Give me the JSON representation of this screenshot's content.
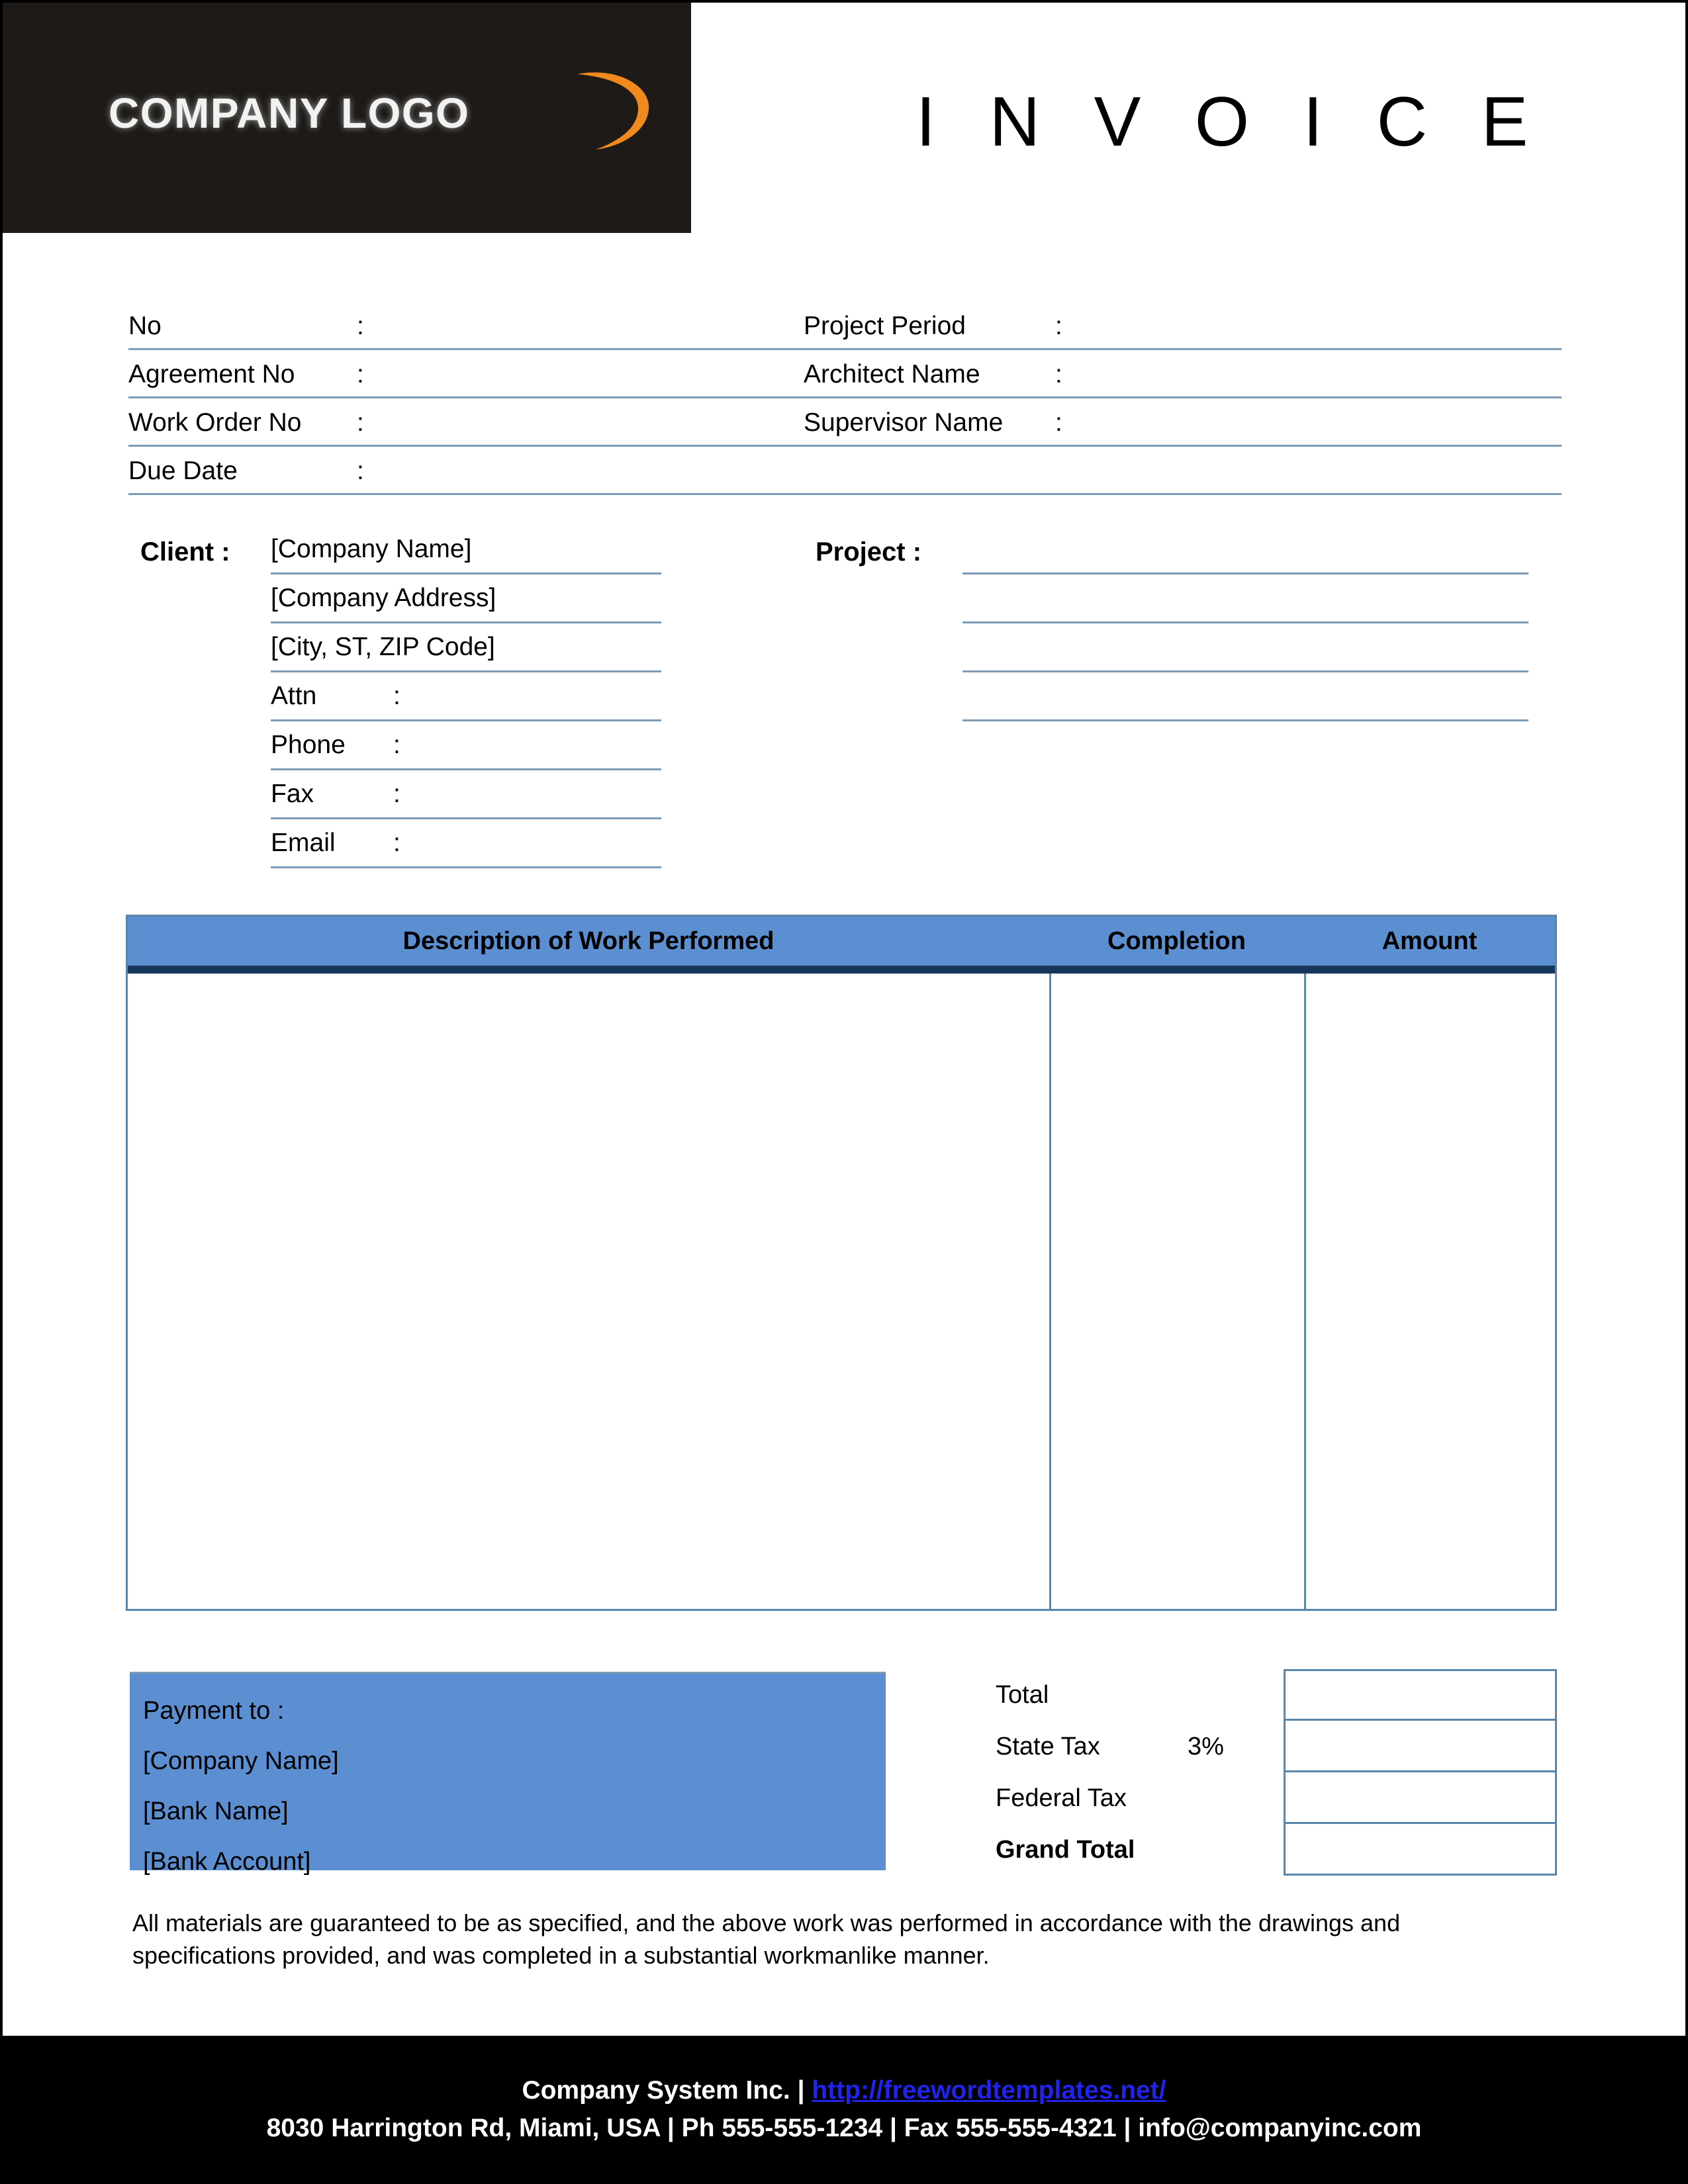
{
  "header": {
    "logo_text": "COMPANY LOGO",
    "logo_swoosh_icon": "orange-swoosh-icon",
    "title": "I N V O I C E"
  },
  "info_fields": [
    {
      "label": "No",
      "colon": ":",
      "value": "",
      "label2": "Project Period",
      "colon2": ":",
      "value2": ""
    },
    {
      "label": "Agreement No",
      "colon": ":",
      "value": "",
      "label2": "Architect Name",
      "colon2": ":",
      "value2": ""
    },
    {
      "label": "Work Order No",
      "colon": ":",
      "value": "",
      "label2": "Supervisor Name",
      "colon2": ":",
      "value2": ""
    },
    {
      "label": "Due Date",
      "colon": ":",
      "value": "",
      "label2": "",
      "colon2": "",
      "value2": ""
    }
  ],
  "client": {
    "heading": "Client  :",
    "lines": [
      {
        "text": "[Company Name]"
      },
      {
        "text": "[Company Address]"
      },
      {
        "text": "[City, ST, ZIP Code]"
      }
    ],
    "contact": [
      {
        "label": "Attn",
        "colon": ":",
        "value": ""
      },
      {
        "label": "Phone",
        "colon": ":",
        "value": ""
      },
      {
        "label": "Fax",
        "colon": ":",
        "value": ""
      },
      {
        "label": "Email",
        "colon": ":",
        "value": ""
      }
    ]
  },
  "project": {
    "heading": "Project  :",
    "lines": [
      "",
      "",
      "",
      ""
    ]
  },
  "work_table": {
    "columns": [
      "Description of Work Performed",
      "Completion",
      "Amount"
    ],
    "rows": []
  },
  "payment": {
    "title": "Payment to :",
    "lines": [
      "[Company Name]",
      "[Bank Name]",
      "[Bank Account]"
    ]
  },
  "totals": [
    {
      "label": "Total",
      "rate": "",
      "value": ""
    },
    {
      "label": "State Tax",
      "rate": "3%",
      "value": ""
    },
    {
      "label": "Federal Tax",
      "rate": "",
      "value": ""
    },
    {
      "label": "Grand Total",
      "rate": "",
      "value": ""
    }
  ],
  "guarantee_text": "All materials are guaranteed to be as specified, and the above work was performed in accordance with the drawings and specifications provided, and was completed in a substantial workmanlike manner.",
  "footer": {
    "company": "Company System Inc. |",
    "url": "http://freewordtemplates.net/",
    "address_line": "8030 Harrington Rd, Miami, USA | Ph 555-555-1234 | Fax 555-555-4321 | info@companyinc.com"
  },
  "colors": {
    "header_black": "#1d1a17",
    "accent_blue": "#5b8fd1",
    "dark_navy": "#16365c",
    "rule_blue": "#7e9bb5",
    "border_blue": "#5a86ab",
    "swoosh_orange": "#f08a1e",
    "link_blue": "#2222ee"
  }
}
